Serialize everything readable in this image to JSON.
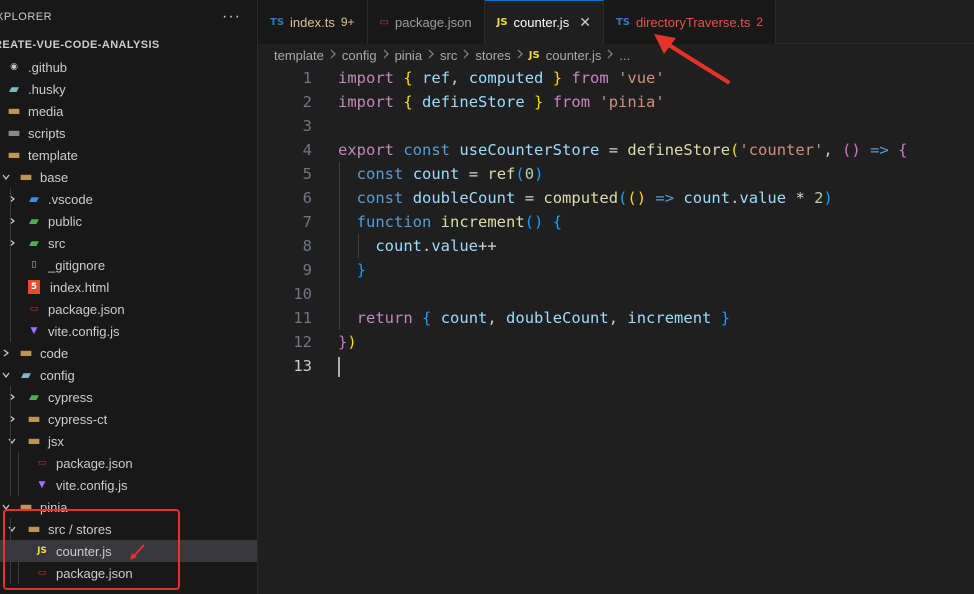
{
  "sidebar": {
    "title": "XPLORER",
    "more": "···",
    "project": "REATE-VUE-CODE-ANALYSIS",
    "tree": [
      {
        "label": ".github",
        "icon": "github-folder-icon",
        "depth": 0,
        "chevron": "",
        "glyph": "◉",
        "color": "#c5c5c5"
      },
      {
        "label": ".husky",
        "icon": "husky-folder-icon",
        "depth": 0,
        "chevron": "",
        "glyph": "▰",
        "color": "#7fb5c9"
      },
      {
        "label": "media",
        "icon": "folder-icon",
        "depth": 0,
        "chevron": "",
        "glyph": "▬",
        "color": "#c09553"
      },
      {
        "label": "scripts",
        "icon": "folder-icon",
        "depth": 0,
        "chevron": "",
        "glyph": "▬",
        "color": "#8a8a8a"
      },
      {
        "label": "template",
        "icon": "folder-open-icon",
        "depth": 0,
        "chevron": "",
        "glyph": "▬",
        "color": "#c09553"
      },
      {
        "label": "base",
        "icon": "folder-open-icon",
        "depth": 1,
        "chevron": "down",
        "glyph": "▬",
        "color": "#c09553"
      },
      {
        "label": ".vscode",
        "icon": "vscode-folder-icon",
        "depth": 2,
        "chevron": "right",
        "glyph": "▰",
        "color": "#3b8fdb"
      },
      {
        "label": "public",
        "icon": "public-folder-icon",
        "depth": 2,
        "chevron": "right",
        "glyph": "▰",
        "color": "#4caf50"
      },
      {
        "label": "src",
        "icon": "src-folder-icon",
        "depth": 2,
        "chevron": "right",
        "glyph": "▰",
        "color": "#4caf50"
      },
      {
        "label": "_gitignore",
        "icon": "file-icon",
        "depth": 2,
        "chevron": "",
        "glyph": "▯",
        "color": "#bbbbbb"
      },
      {
        "label": "index.html",
        "icon": "html-icon",
        "depth": 2,
        "chevron": "",
        "glyph": "5",
        "color": "#e44d26"
      },
      {
        "label": "package.json",
        "icon": "npm-icon",
        "depth": 2,
        "chevron": "",
        "glyph": "▭",
        "color": "#cb3837"
      },
      {
        "label": "vite.config.js",
        "icon": "vite-icon",
        "depth": 2,
        "chevron": "",
        "glyph": "▼",
        "color": "#a96bff"
      },
      {
        "label": "code",
        "icon": "folder-icon",
        "depth": 1,
        "chevron": "right",
        "glyph": "▬",
        "color": "#c09553"
      },
      {
        "label": "config",
        "icon": "config-folder-icon",
        "depth": 1,
        "chevron": "down",
        "glyph": "▰",
        "color": "#7fb5c9"
      },
      {
        "label": "cypress",
        "icon": "cypress-folder-icon",
        "depth": 2,
        "chevron": "right",
        "glyph": "▰",
        "color": "#4caf50"
      },
      {
        "label": "cypress-ct",
        "icon": "folder-icon",
        "depth": 2,
        "chevron": "right",
        "glyph": "▬",
        "color": "#c09553"
      },
      {
        "label": "jsx",
        "icon": "folder-open-icon",
        "depth": 2,
        "chevron": "down",
        "glyph": "▬",
        "color": "#c09553"
      },
      {
        "label": "package.json",
        "icon": "npm-icon",
        "depth": 3,
        "chevron": "",
        "glyph": "▭",
        "color": "#cb3837"
      },
      {
        "label": "vite.config.js",
        "icon": "vite-icon",
        "depth": 3,
        "chevron": "",
        "glyph": "▼",
        "color": "#a96bff"
      },
      {
        "label": "pinia",
        "icon": "folder-open-icon",
        "depth": 1,
        "chevron": "down",
        "glyph": "▬",
        "color": "#c09553"
      },
      {
        "label": "src / stores",
        "icon": "folder-open-icon",
        "depth": 2,
        "chevron": "down",
        "glyph": "▬",
        "color": "#c09553"
      },
      {
        "label": "counter.js",
        "icon": "js-icon",
        "depth": 3,
        "chevron": "",
        "glyph": "JS",
        "color": "#f1dd35",
        "selected": true
      },
      {
        "label": "package.json",
        "icon": "npm-icon",
        "depth": 3,
        "chevron": "",
        "glyph": "▭",
        "color": "#cb3837"
      }
    ]
  },
  "tabs": [
    {
      "icon": "TS",
      "icon_color": "#3178c6",
      "label": "index.ts",
      "label_color": "#e2c08d",
      "badge": "9+",
      "badge_color": "#e2c08d",
      "active": false
    },
    {
      "icon": "▭",
      "icon_color": "#cb3837",
      "label": "package.json",
      "label_color": "#9d9d9d",
      "badge": "",
      "active": false
    },
    {
      "icon": "JS",
      "icon_color": "#f1dd35",
      "label": "counter.js",
      "label_color": "#ffffff",
      "badge": "",
      "active": true,
      "close": "✕"
    },
    {
      "icon": "TS",
      "icon_color": "#3178c6",
      "label": "directoryTraverse.ts",
      "label_color": "#f14c4c",
      "badge": "2",
      "badge_color": "#f14c4c",
      "active": false
    }
  ],
  "breadcrumb": {
    "items": [
      "template",
      "config",
      "pinia",
      "src",
      "stores"
    ],
    "file_icon": "JS",
    "file": "counter.js",
    "tail": "..."
  },
  "editor": {
    "active_line": 13,
    "lines": [
      "1",
      "2",
      "3",
      "4",
      "5",
      "6",
      "7",
      "8",
      "9",
      "10",
      "11",
      "12",
      "13"
    ]
  },
  "colors": {
    "annotation": "#e5332a",
    "accent": "#0078d4"
  }
}
